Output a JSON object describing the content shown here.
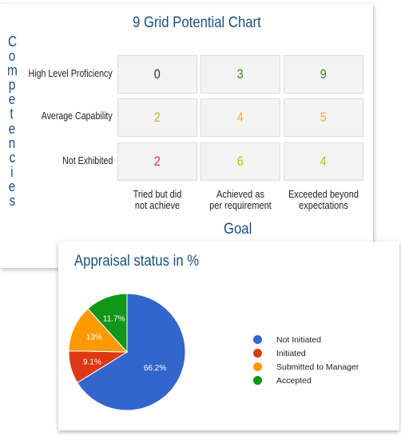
{
  "grid_card": {
    "title": "9 Grid Potential Chart",
    "vertical_axis_letters": [
      "C",
      "o",
      "m",
      "p",
      "e",
      "t",
      "e",
      "n",
      "c",
      "i",
      "e",
      "s"
    ],
    "vertical_axis_label": "Competencies",
    "row_labels": [
      "High Level Proficiency",
      "Average Capability",
      "Not Exhibited"
    ],
    "column_labels": [
      [
        "Tried but did",
        "not achieve"
      ],
      [
        "Achieved as",
        "per requirement"
      ],
      [
        "Exceeded beyond",
        "expectations"
      ]
    ],
    "goal_label": "Goal",
    "cells": [
      [
        {
          "value": "0",
          "color": "#333333"
        },
        {
          "value": "3",
          "color": "#3d8b1e"
        },
        {
          "value": "9",
          "color": "#3d8b1e"
        }
      ],
      [
        {
          "value": "2",
          "color": "#c9bd12"
        },
        {
          "value": "4",
          "color": "#f2b418"
        },
        {
          "value": "5",
          "color": "#f2b418"
        }
      ],
      [
        {
          "value": "2",
          "color": "#e8293a"
        },
        {
          "value": "6",
          "color": "#c9bd12"
        },
        {
          "value": "4",
          "color": "#c9bd12"
        }
      ]
    ]
  },
  "pie_card": {
    "title": "Appraisal status in %"
  },
  "chart_data": {
    "type": "pie",
    "title": "Appraisal status in %",
    "slices": [
      {
        "label": "Not Initiated",
        "value": 66.2,
        "display": "66.2%",
        "color": "#3366cc"
      },
      {
        "label": "Initiated",
        "value": 9.1,
        "display": "9.1%",
        "color": "#dc3912"
      },
      {
        "label": "Submitted to Manager",
        "value": 13,
        "display": "13%",
        "color": "#ff9900"
      },
      {
        "label": "Accepted",
        "value": 11.7,
        "display": "11.7%",
        "color": "#109618"
      }
    ],
    "legend_position": "right"
  }
}
